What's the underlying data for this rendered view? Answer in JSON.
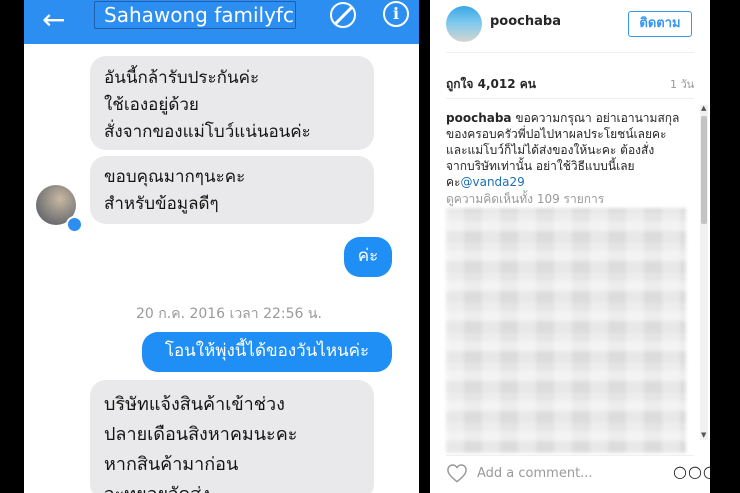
{
  "chat": {
    "title": "Sahawong familyfc",
    "back_icon": "arrow-left-icon",
    "block_icon": "block-icon",
    "info_icon": "info-icon",
    "messages": [
      {
        "direction": "incoming",
        "lines": [
          "อันนี้กล้ารับประกันค่ะ",
          "ใช้เองอยู่ด้วย",
          "สั่งจากของแม่โบว์แน่นอนค่ะ"
        ]
      },
      {
        "direction": "incoming",
        "lines": [
          "ขอบคุณมากๆนะคะ",
          "สำหรับข้อมูลดีๆ"
        ]
      },
      {
        "direction": "outgoing",
        "lines": [
          "ค่ะ"
        ]
      },
      {
        "direction": "outgoing",
        "lines": [
          "โอนให้พุ่งนี้ได้ของวันไหนค่ะ"
        ]
      },
      {
        "direction": "incoming",
        "lines": [
          "บริษัทแจ้งสินค้าเข้าช่วง",
          "ปลายเดือนสิงหาคมนะคะ",
          "หากสินค้ามาก่อน",
          "จะทยอยจัดส่ง"
        ]
      }
    ],
    "timestamp": "20 ก.ค. 2016 เวลา 22:56 น.",
    "colors": {
      "header": "#2d8ef1",
      "outgoing": "#1f8ff6",
      "incoming": "#e9e9eb"
    }
  },
  "instagram": {
    "username": "poochaba",
    "follow_label": "ติดตาม",
    "likes": "ถูกใจ 4,012 คน",
    "time_ago": "1 วัน",
    "caption_user": "poochaba",
    "caption_lines": [
      "ขอความกรุณา อย่าเอานามสกุล",
      "ของครอบครัวพี่ปอไปหาผลประโยชน์เลยคะ",
      "และแม่โบว์ก็ไม่ได้ส่งของให้นะคะ ต้องสั่ง",
      "จากบริษัทเท่านั้น อย่าใช้วิธีแบบนี้เลย"
    ],
    "caption_end": "คะ",
    "mention": "@vanda29",
    "view_comments": "ดูความคิดเห็นทั้ง 109 รายการ",
    "add_comment_placeholder": "Add a comment...",
    "heart_icon": "heart-icon",
    "more_icon": "more-options-icon",
    "colors": {
      "link": "#3897f0"
    }
  }
}
